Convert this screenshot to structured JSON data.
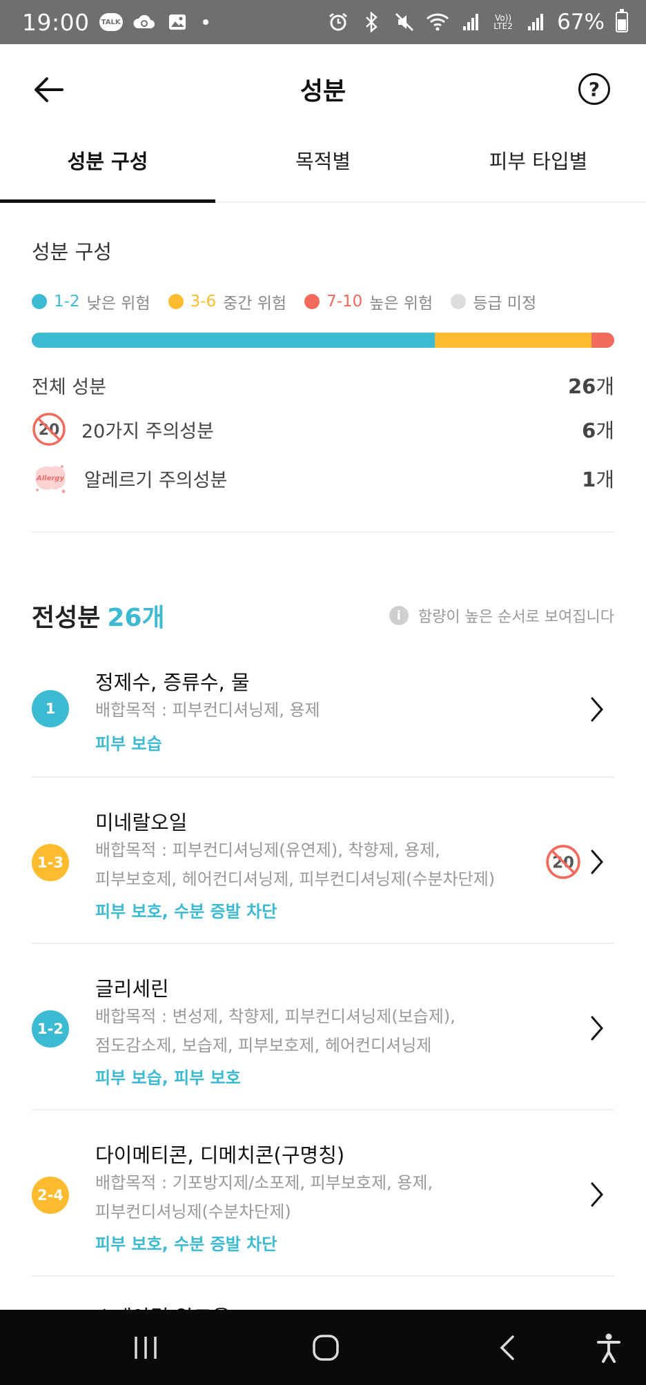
{
  "status_bar": {
    "time": "19:00",
    "talk_label": "TALK",
    "battery": "67%"
  },
  "header": {
    "title": "성분",
    "help_label": "?"
  },
  "tabs": [
    {
      "label": "성분 구성",
      "active": true
    },
    {
      "label": "목적별",
      "active": false
    },
    {
      "label": "피부 타입별",
      "active": false
    }
  ],
  "composition": {
    "title": "성분 구성",
    "legend": [
      {
        "range": "1-2",
        "label": "낮은 위험",
        "color": "#3bbad1"
      },
      {
        "range": "3-6",
        "label": "중간 위험",
        "color": "#fdbb2d"
      },
      {
        "range": "7-10",
        "label": "높은 위험",
        "color": "#f26a5b"
      },
      {
        "range": "",
        "label": "등급 미정",
        "color": "#dddddd"
      }
    ],
    "bar_fractions": [
      0.692,
      0.269,
      0.039
    ],
    "total_label": "전체 성분",
    "total_value": "26",
    "unit": "개",
    "twenty_label": "20가지 주의성분",
    "twenty_value": "6",
    "twenty_icon_text": "20",
    "allergy_label": "알레르기 주의성분",
    "allergy_value": "1",
    "allergy_icon_text": "Allergy"
  },
  "list": {
    "title": "전성분",
    "count": "26개",
    "note": "함량이 높은 순서로 보여집니다",
    "items": [
      {
        "grade": "1",
        "grade_color": "#3bbad1",
        "name": "정제수, 증류수, 물",
        "purpose_lines": [
          "배합목적 : 피부컨디셔닝제, 용제"
        ],
        "effect": "피부 보습",
        "twenty": false
      },
      {
        "grade": "1-3",
        "grade_color": "#fdbb2d",
        "name": "미네랄오일",
        "purpose_lines": [
          "배합목적 : 피부컨디셔닝제(유연제), 착향제, 용제,",
          "피부보호제, 헤어컨디셔닝제, 피부컨디셔닝제(수분차단제)"
        ],
        "effect": "피부 보호, 수분 증발 차단",
        "twenty": true,
        "twenty_text": "20"
      },
      {
        "grade": "1-2",
        "grade_color": "#3bbad1",
        "name": "글리세린",
        "purpose_lines": [
          "배합목적 : 변성제, 착향제, 피부컨디셔닝제(보습제),",
          "점도감소제, 보습제, 피부보호제, 헤어컨디셔닝제"
        ],
        "effect": "피부 보습, 피부 보호",
        "twenty": false
      },
      {
        "grade": "2-4",
        "grade_color": "#fdbb2d",
        "name": "다이메티콘, 디메치콘(구명칭)",
        "purpose_lines": [
          "배합목적 : 기포방지제/소포제, 피부보호제, 용제,",
          "피부컨디셔닝제(수분차단제)"
        ],
        "effect": "피부 보호, 수분 증발 차단",
        "twenty": false
      }
    ],
    "partial_text": "스테아릴 알코올"
  }
}
